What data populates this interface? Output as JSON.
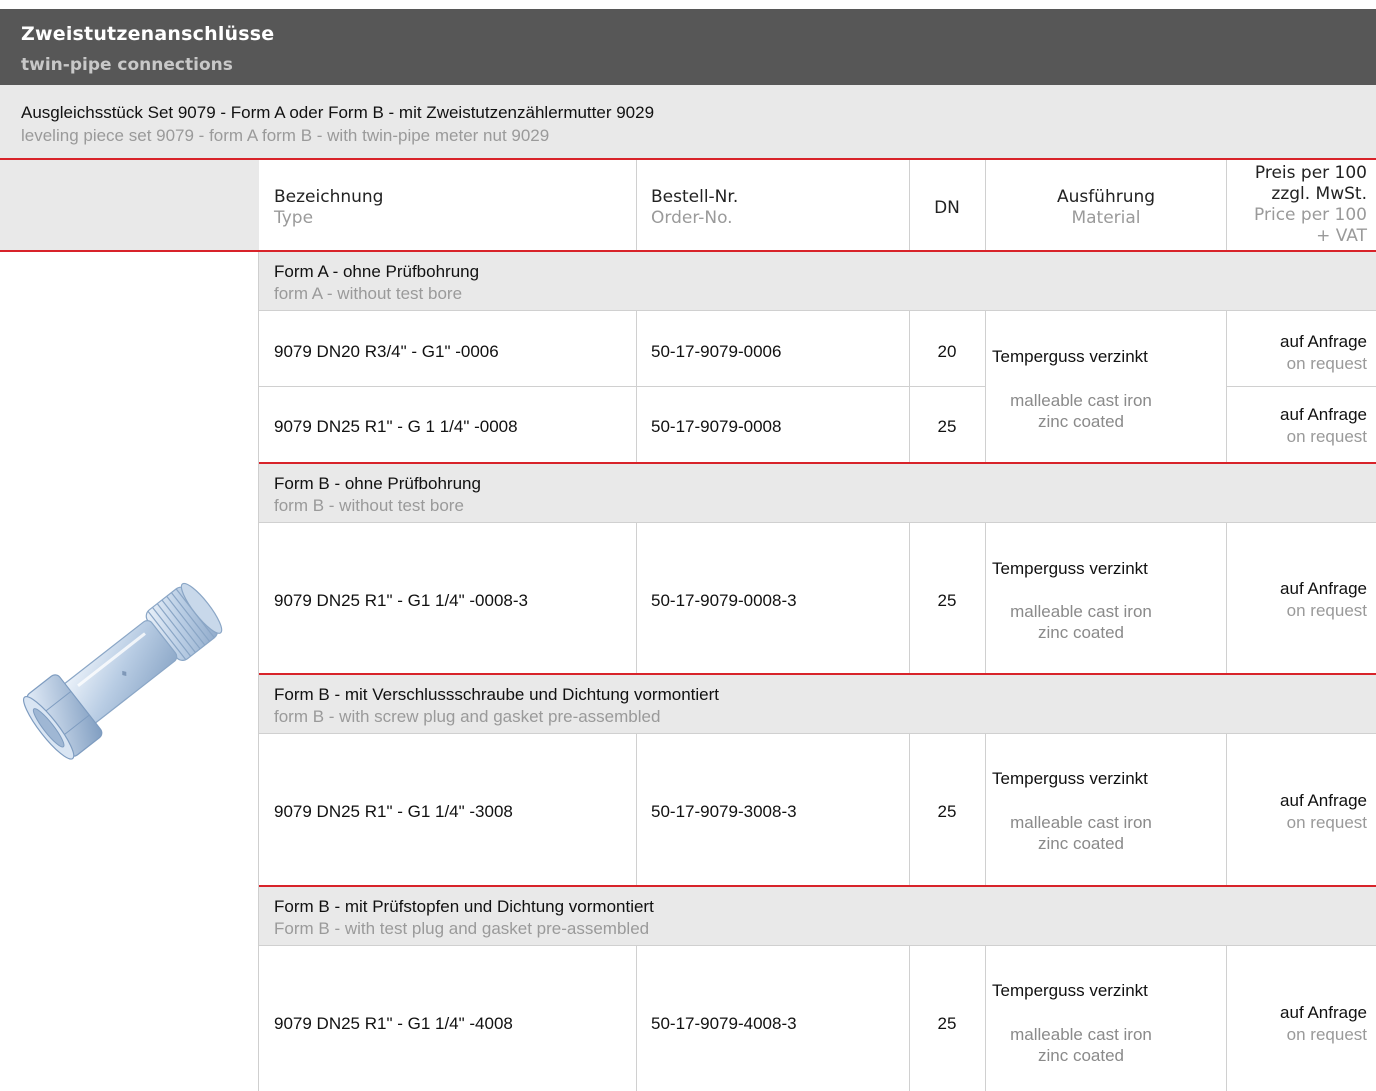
{
  "header": {
    "title_de": "Zweistutzenanschlüsse",
    "title_en": "twin-pipe connections",
    "bg_color": "#575757"
  },
  "subheader": {
    "title_de": "Ausgleichsstück Set 9079 - Form A oder Form B - mit Zweistutzenzählermutter 9029",
    "title_en": "leveling piece set 9079 - form A form B - with twin-pipe meter nut 9029"
  },
  "columns": {
    "type_de": "Bezeichnung",
    "type_en": "Type",
    "order_de": "Bestell-Nr.",
    "order_en": "Order-No.",
    "dn": "DN",
    "material_de": "Ausführung",
    "material_en": "Material",
    "price_de_1": "Preis per 100",
    "price_de_2": "zzgl. MwSt.",
    "price_en_1": "Price per 100",
    "price_en_2": "+ VAT"
  },
  "accent_color": "#d8232a",
  "product_image": {
    "icon": "pipe-fitting-icon"
  },
  "groups": [
    {
      "title_de": "Form A - ohne Prüfbohrung",
      "title_en": "form A - without test bore",
      "rows": [
        {
          "type": "9079 DN20 R3/4\" - G1\" -0006",
          "order": "50-17-9079-0006",
          "dn": "20",
          "price_de": "auf Anfrage",
          "price_en": "on request"
        },
        {
          "type": "9079 DN25 R1\" - G 1 1/4\" -0008",
          "order": "50-17-9079-0008",
          "dn": "25",
          "price_de": "auf Anfrage",
          "price_en": "on request"
        }
      ],
      "material_de": "Temperguss verzinkt",
      "material_en_1": "malleable cast iron",
      "material_en_2": "zinc coated"
    },
    {
      "title_de": "Form B - ohne Prüfbohrung",
      "title_en": "form B - without test bore",
      "rows": [
        {
          "type": "9079 DN25 R1\" - G1 1/4\" -0008-3",
          "order": "50-17-9079-0008-3",
          "dn": "25",
          "price_de": "auf Anfrage",
          "price_en": "on request"
        }
      ],
      "material_de": "Temperguss verzinkt",
      "material_en_1": "malleable cast iron",
      "material_en_2": "zinc coated"
    },
    {
      "title_de": "Form B - mit Verschlussschraube und Dichtung vormontiert",
      "title_en": "form B - with screw plug and gasket pre-assembled",
      "rows": [
        {
          "type": "9079 DN25 R1\" - G1 1/4\" -3008",
          "order": "50-17-9079-3008-3",
          "dn": "25",
          "price_de": "auf Anfrage",
          "price_en": "on request"
        }
      ],
      "material_de": "Temperguss verzinkt",
      "material_en_1": "malleable cast iron",
      "material_en_2": "zinc coated"
    },
    {
      "title_de": "Form B - mit Prüfstopfen und Dichtung vormontiert",
      "title_en": "Form B - with test plug and gasket pre-assembled",
      "rows": [
        {
          "type": "9079 DN25 R1\" - G1 1/4\" -4008",
          "order": "50-17-9079-4008-3",
          "dn": "25",
          "price_de": "auf Anfrage",
          "price_en": "on request"
        }
      ],
      "material_de": "Temperguss verzinkt",
      "material_en_1": "malleable cast iron",
      "material_en_2": "zinc coated"
    }
  ]
}
